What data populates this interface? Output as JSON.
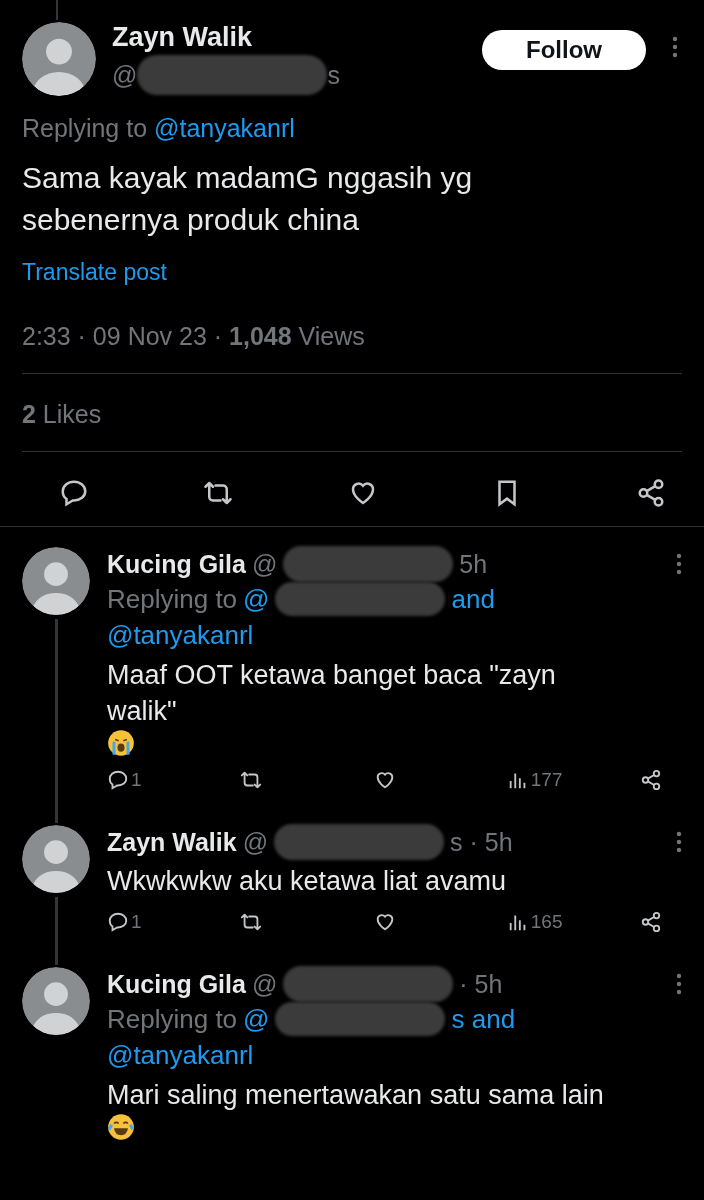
{
  "post": {
    "author": "Zayn Walik",
    "handle_start": "@",
    "handle_end": "s",
    "follow_label": "Follow",
    "replying_label": "Replying to",
    "replying_mention": "@tanyakanrl",
    "text": "Sama kayak madamG nggasih yg sebenernya produk china",
    "translate": "Translate post",
    "meta": "2:33 · 09 Nov 23 · **1,048** Views",
    "likes": "**2** Likes"
  },
  "replies": [
    {
      "author": "Kucing Gila",
      "handle_start": "@",
      "handle_end": "5h",
      "replying_label": "Replying to",
      "mention_start": "@",
      "mention_end": "and",
      "mention_second": "@tanyakanrl",
      "text": "Maaf OOT ketawa banget baca \"zayn walik\"",
      "emoji": {
        "kind": "crying"
      },
      "reply_count": "1",
      "views": "177",
      "thread_line": true
    },
    {
      "author": "Zayn Walik",
      "handle_start": "@",
      "handle_end": "s · 5h",
      "text": "Wkwkwkw aku ketawa liat avamu",
      "reply_count": "1",
      "views": "165",
      "thread_line": true
    },
    {
      "author": "Kucing Gila",
      "handle_start": "@",
      "handle_end": "· 5h",
      "replying_label": "Replying to",
      "mention_start": "@",
      "mention_end": "s and",
      "mention_second": "@tanyakanrl",
      "text": "Mari saling menertawakan satu sama lain",
      "emoji": {
        "kind": "laughing"
      },
      "thread_line": false
    }
  ]
}
